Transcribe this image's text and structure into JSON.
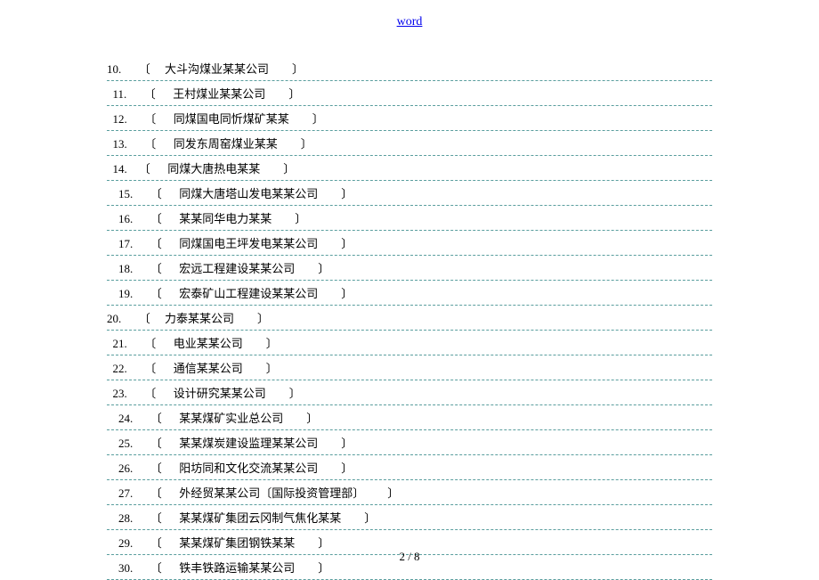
{
  "header": {
    "link": "word"
  },
  "rows": [
    {
      "num": "10.",
      "name": "大斗沟煤业某某公司"
    },
    {
      "num": "11.",
      "name": "王村煤业某某公司"
    },
    {
      "num": "12.",
      "name": "同煤国电同忻煤矿某某"
    },
    {
      "num": "13.",
      "name": "同发东周窑煤业某某"
    },
    {
      "num": "14.",
      "name": "同煤大唐热电某某"
    },
    {
      "num": "15.",
      "name": "同煤大唐塔山发电某某公司"
    },
    {
      "num": "16.",
      "name": "某某同华电力某某"
    },
    {
      "num": "17.",
      "name": "同煤国电王坪发电某某公司"
    },
    {
      "num": "18.",
      "name": "宏远工程建设某某公司"
    },
    {
      "num": "19.",
      "name": "宏泰矿山工程建设某某公司"
    },
    {
      "num": "20.",
      "name": "力泰某某公司"
    },
    {
      "num": "21.",
      "name": "电业某某公司"
    },
    {
      "num": "22.",
      "name": "通信某某公司"
    },
    {
      "num": "23.",
      "name": "设计研究某某公司"
    },
    {
      "num": "24.",
      "name": "某某煤矿实业总公司"
    },
    {
      "num": "25.",
      "name": "某某煤炭建设监理某某公司"
    },
    {
      "num": "26.",
      "name": "阳坊同和文化交流某某公司"
    },
    {
      "num": "27.",
      "name": "外经贸某某公司〔国际投资管理部〕"
    },
    {
      "num": "28.",
      "name": "某某煤矿集团云冈制气焦化某某"
    },
    {
      "num": "29.",
      "name": "某某煤矿集团钢铁某某"
    },
    {
      "num": "30.",
      "name": "铁丰铁路运输某某公司"
    }
  ],
  "footer": {
    "page": "2 / 8"
  }
}
